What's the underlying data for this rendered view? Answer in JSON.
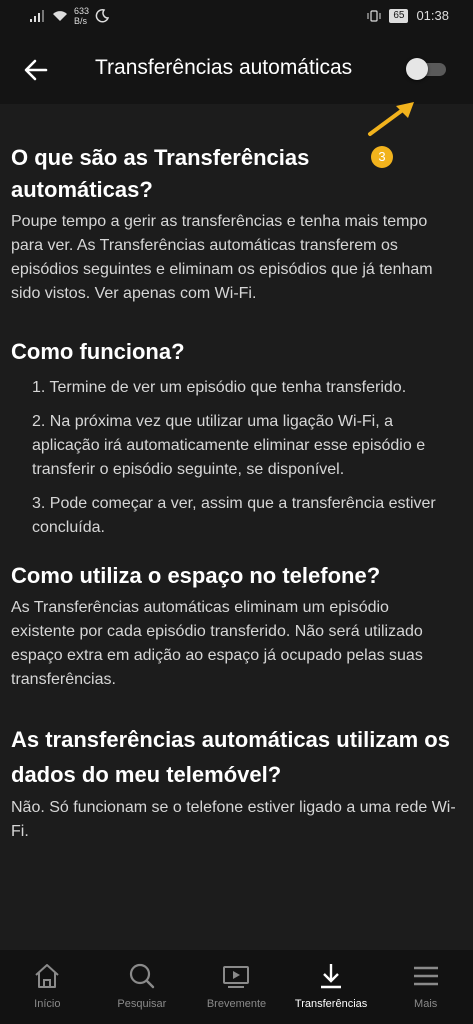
{
  "status_bar": {
    "net_speed": "633",
    "net_unit": "B/s",
    "battery": "65",
    "time": "01:38"
  },
  "header": {
    "title": "Transferências automáticas",
    "toggle_on": false
  },
  "annotation": {
    "step": "3",
    "color": "#f2b31d"
  },
  "sections": [
    {
      "heading": "O que são as Transferências automáticas?",
      "body": "Poupe tempo a gerir as transferências e tenha mais tempo para ver. As Transferências automáticas transferem os episódios seguintes e eliminam os episódios que já tenham sido vistos. Ver apenas com Wi-Fi."
    },
    {
      "heading": "Como funciona?",
      "steps": [
        "1. Termine de ver um episódio que tenha transferido.",
        "2. Na próxima vez que utilizar uma ligação Wi-Fi, a aplicação irá automaticamente eliminar esse episódio e transferir o episódio seguinte, se disponível.",
        "3. Pode começar a ver, assim que a transferência estiver concluída."
      ]
    },
    {
      "heading": "Como utiliza o espaço no telefone?",
      "body": "As Transferências automáticas eliminam um episódio existente por cada episódio transferido. Não será utilizado espaço extra em adição ao espaço já ocupado pelas suas transferências."
    },
    {
      "heading": "As transferências automáticas utilizam os dados do meu telemóvel?",
      "body": "Não. Só funcionam se o telefone estiver ligado a uma rede Wi-Fi."
    }
  ],
  "nav": [
    {
      "label": "Início",
      "icon": "home-icon"
    },
    {
      "label": "Pesquisar",
      "icon": "search-icon"
    },
    {
      "label": "Brevemente",
      "icon": "play-icon"
    },
    {
      "label": "Transferências",
      "icon": "download-icon",
      "active": true
    },
    {
      "label": "Mais",
      "icon": "menu-icon"
    }
  ]
}
